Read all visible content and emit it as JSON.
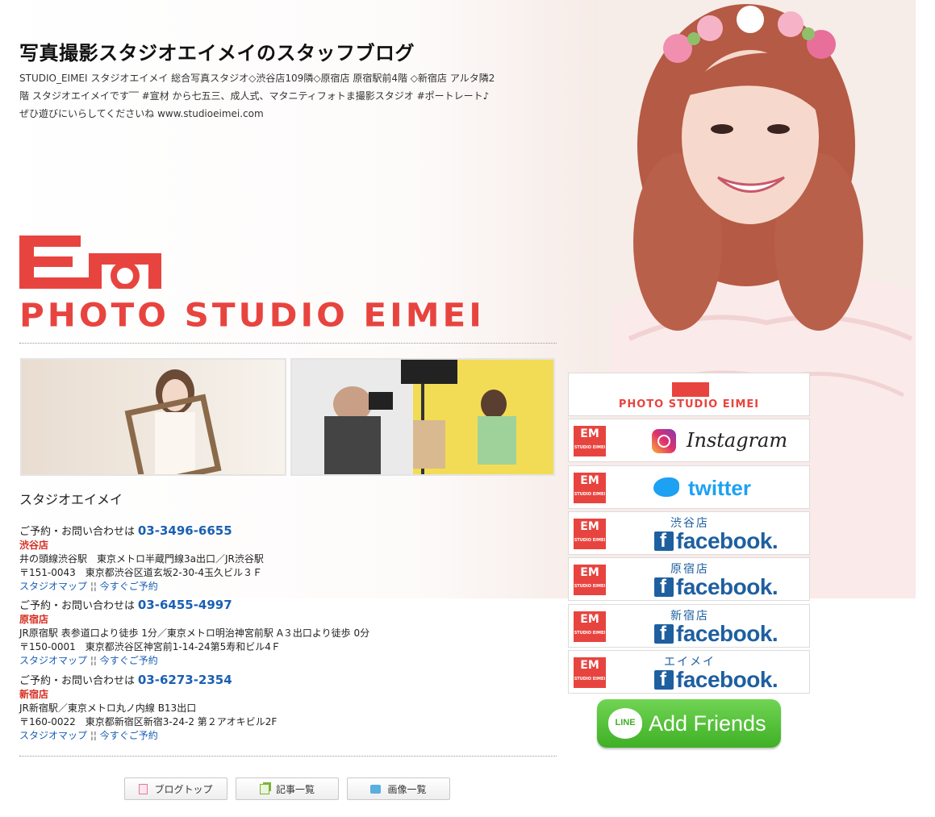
{
  "header": {
    "title": "写真撮影スタジオエイメイのスタッフブログ",
    "description": "STUDIO_EIMEI スタジオエイメイ 総合写真スタジオ◇渋谷店109隣◇原宿店 原宿駅前4階 ◇新宿店 アルタ隣2階 スタジオエイメイです‾‾ #宣材 から七五三、成人式、マタニティフォトま撮影スタジオ #ポートレート♪ ぜひ遊びにいらしてくださいね www.studioeimei.com"
  },
  "logo": {
    "mark": "EM",
    "text": "PHOTO STUDIO EIMEI",
    "color": "#e8443f"
  },
  "studio_name": "スタジオエイメイ",
  "branches": [
    {
      "ask": "ご予約・お問い合わせは",
      "tel": "03-3496-6655",
      "name": "渋谷店",
      "access": "井の頭線渋谷駅　東京メトロ半蔵門線3a出口／JR渋谷駅",
      "address": "〒151-0043　東京都渋谷区道玄坂2-30-4玉久ビル３Ｆ",
      "map_link": "スタジオマップ",
      "sep": "¦¦",
      "reserve_link": "今すぐご予約"
    },
    {
      "ask": "ご予約・お問い合わせは",
      "tel": "03-6455-4997",
      "name": "原宿店",
      "access": "JR原宿駅 表参道口より徒歩 1分／東京メトロ明治神宮前駅 A３出口より徒歩 0分",
      "address": "〒150-0001　東京都渋谷区神宮前1-14-24第5寿和ビル4Ｆ",
      "map_link": "スタジオマップ",
      "sep": "¦¦",
      "reserve_link": "今すぐご予約"
    },
    {
      "ask": "ご予約・お問い合わせは",
      "tel": "03-6273-2354",
      "name": "新宿店",
      "access": "JR新宿駅／東京メトロ丸ノ内線 B13出口",
      "address": "〒160-0022　東京都新宿区新宿3-24-2 第２アオキビル2F",
      "map_link": "スタジオマップ",
      "sep": "¦¦",
      "reserve_link": "今すぐご予約"
    }
  ],
  "nav": {
    "blog_top": "ブログトップ",
    "articles": "記事一覧",
    "images": "画像一覧"
  },
  "sidebar": {
    "main_banner": "PHOTO STUDIO EIMEI",
    "em_mark": "EM",
    "studio_tag": "STUDIO EIMEI",
    "instagram": "Instagram",
    "twitter": "twitter",
    "facebook_word": "facebook.",
    "facebook_pages": [
      {
        "label": "渋谷店"
      },
      {
        "label": "原宿店"
      },
      {
        "label": "新宿店"
      },
      {
        "label": "エイメイ"
      }
    ],
    "line": {
      "icon": "LINE",
      "text": "Add Friends",
      "color": "#3fb025"
    }
  },
  "colors": {
    "accent": "#e8443f",
    "link": "#1a5fb4",
    "branch_name": "#d62b1f",
    "facebook": "#1e5fa0"
  }
}
